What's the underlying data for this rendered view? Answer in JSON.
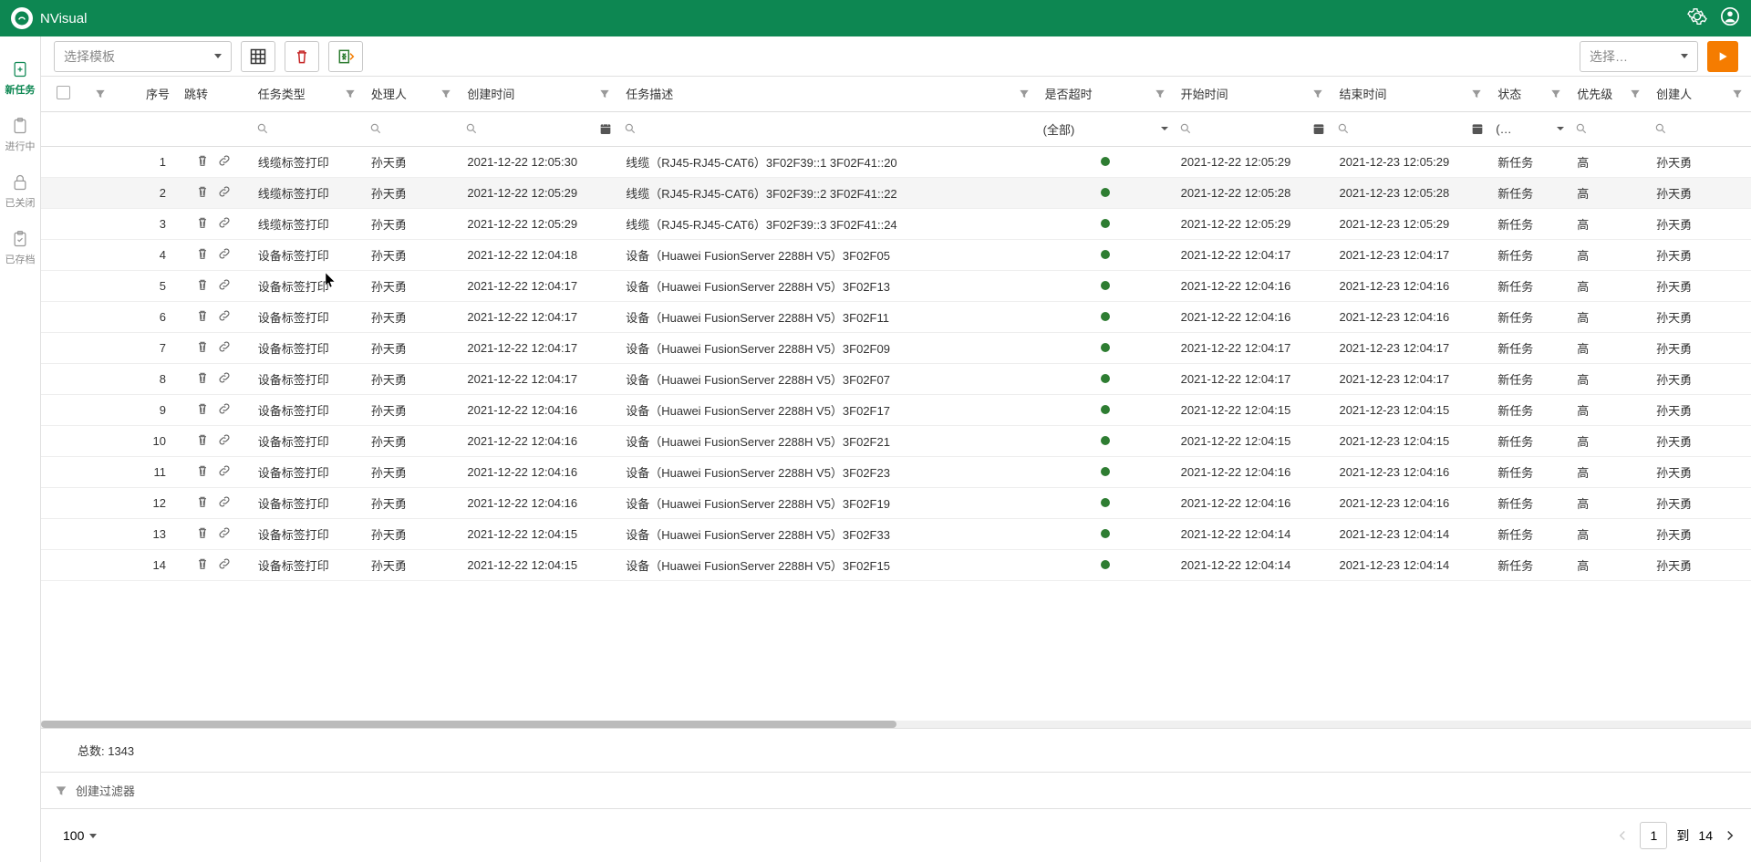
{
  "header": {
    "title": "NVisual"
  },
  "sidebar": {
    "items": [
      {
        "label": "新任务"
      },
      {
        "label": "进行中"
      },
      {
        "label": "已关闭"
      },
      {
        "label": "已存档"
      }
    ]
  },
  "toolbar": {
    "template_placeholder": "选择模板",
    "select_placeholder": "选择…"
  },
  "columns": {
    "seq": "序号",
    "jump": "跳转",
    "task_type": "任务类型",
    "handler": "处理人",
    "create_time": "创建时间",
    "task_desc": "任务描述",
    "overdue": "是否超时",
    "start_time": "开始时间",
    "end_time": "结束时间",
    "status": "状态",
    "priority": "优先级",
    "creator": "创建人"
  },
  "filters": {
    "overdue_all": "(全部)",
    "status_placeholder": "(…"
  },
  "rows": [
    {
      "n": 1,
      "type": "线缆标签打印",
      "handler": "孙天勇",
      "ctime": "2021-12-22 12:05:30",
      "desc": "线缆（RJ45-RJ45-CAT6）3F02F39::1 3F02F41::20",
      "stime": "2021-12-22 12:05:29",
      "etime": "2021-12-23 12:05:29",
      "status": "新任务",
      "prio": "高",
      "creator": "孙天勇"
    },
    {
      "n": 2,
      "type": "线缆标签打印",
      "handler": "孙天勇",
      "ctime": "2021-12-22 12:05:29",
      "desc": "线缆（RJ45-RJ45-CAT6）3F02F39::2 3F02F41::22",
      "stime": "2021-12-22 12:05:28",
      "etime": "2021-12-23 12:05:28",
      "status": "新任务",
      "prio": "高",
      "creator": "孙天勇"
    },
    {
      "n": 3,
      "type": "线缆标签打印",
      "handler": "孙天勇",
      "ctime": "2021-12-22 12:05:29",
      "desc": "线缆（RJ45-RJ45-CAT6）3F02F39::3 3F02F41::24",
      "stime": "2021-12-22 12:05:29",
      "etime": "2021-12-23 12:05:29",
      "status": "新任务",
      "prio": "高",
      "creator": "孙天勇"
    },
    {
      "n": 4,
      "type": "设备标签打印",
      "handler": "孙天勇",
      "ctime": "2021-12-22 12:04:18",
      "desc": "设备（Huawei FusionServer 2288H V5）3F02F05",
      "stime": "2021-12-22 12:04:17",
      "etime": "2021-12-23 12:04:17",
      "status": "新任务",
      "prio": "高",
      "creator": "孙天勇"
    },
    {
      "n": 5,
      "type": "设备标签打印",
      "handler": "孙天勇",
      "ctime": "2021-12-22 12:04:17",
      "desc": "设备（Huawei FusionServer 2288H V5）3F02F13",
      "stime": "2021-12-22 12:04:16",
      "etime": "2021-12-23 12:04:16",
      "status": "新任务",
      "prio": "高",
      "creator": "孙天勇"
    },
    {
      "n": 6,
      "type": "设备标签打印",
      "handler": "孙天勇",
      "ctime": "2021-12-22 12:04:17",
      "desc": "设备（Huawei FusionServer 2288H V5）3F02F11",
      "stime": "2021-12-22 12:04:16",
      "etime": "2021-12-23 12:04:16",
      "status": "新任务",
      "prio": "高",
      "creator": "孙天勇"
    },
    {
      "n": 7,
      "type": "设备标签打印",
      "handler": "孙天勇",
      "ctime": "2021-12-22 12:04:17",
      "desc": "设备（Huawei FusionServer 2288H V5）3F02F09",
      "stime": "2021-12-22 12:04:17",
      "etime": "2021-12-23 12:04:17",
      "status": "新任务",
      "prio": "高",
      "creator": "孙天勇"
    },
    {
      "n": 8,
      "type": "设备标签打印",
      "handler": "孙天勇",
      "ctime": "2021-12-22 12:04:17",
      "desc": "设备（Huawei FusionServer 2288H V5）3F02F07",
      "stime": "2021-12-22 12:04:17",
      "etime": "2021-12-23 12:04:17",
      "status": "新任务",
      "prio": "高",
      "creator": "孙天勇"
    },
    {
      "n": 9,
      "type": "设备标签打印",
      "handler": "孙天勇",
      "ctime": "2021-12-22 12:04:16",
      "desc": "设备（Huawei FusionServer 2288H V5）3F02F17",
      "stime": "2021-12-22 12:04:15",
      "etime": "2021-12-23 12:04:15",
      "status": "新任务",
      "prio": "高",
      "creator": "孙天勇"
    },
    {
      "n": 10,
      "type": "设备标签打印",
      "handler": "孙天勇",
      "ctime": "2021-12-22 12:04:16",
      "desc": "设备（Huawei FusionServer 2288H V5）3F02F21",
      "stime": "2021-12-22 12:04:15",
      "etime": "2021-12-23 12:04:15",
      "status": "新任务",
      "prio": "高",
      "creator": "孙天勇"
    },
    {
      "n": 11,
      "type": "设备标签打印",
      "handler": "孙天勇",
      "ctime": "2021-12-22 12:04:16",
      "desc": "设备（Huawei FusionServer 2288H V5）3F02F23",
      "stime": "2021-12-22 12:04:16",
      "etime": "2021-12-23 12:04:16",
      "status": "新任务",
      "prio": "高",
      "creator": "孙天勇"
    },
    {
      "n": 12,
      "type": "设备标签打印",
      "handler": "孙天勇",
      "ctime": "2021-12-22 12:04:16",
      "desc": "设备（Huawei FusionServer 2288H V5）3F02F19",
      "stime": "2021-12-22 12:04:16",
      "etime": "2021-12-23 12:04:16",
      "status": "新任务",
      "prio": "高",
      "creator": "孙天勇"
    },
    {
      "n": 13,
      "type": "设备标签打印",
      "handler": "孙天勇",
      "ctime": "2021-12-22 12:04:15",
      "desc": "设备（Huawei FusionServer 2288H V5）3F02F33",
      "stime": "2021-12-22 12:04:14",
      "etime": "2021-12-23 12:04:14",
      "status": "新任务",
      "prio": "高",
      "creator": "孙天勇"
    },
    {
      "n": 14,
      "type": "设备标签打印",
      "handler": "孙天勇",
      "ctime": "2021-12-22 12:04:15",
      "desc": "设备（Huawei FusionServer 2288H V5）3F02F15",
      "stime": "2021-12-22 12:04:14",
      "etime": "2021-12-23 12:04:14",
      "status": "新任务",
      "prio": "高",
      "creator": "孙天勇"
    }
  ],
  "footer": {
    "total_label": "总数: 1343",
    "create_filter": "创建过滤器",
    "page_size": "100",
    "page_current": "1",
    "page_to": "到",
    "page_total": "14"
  }
}
